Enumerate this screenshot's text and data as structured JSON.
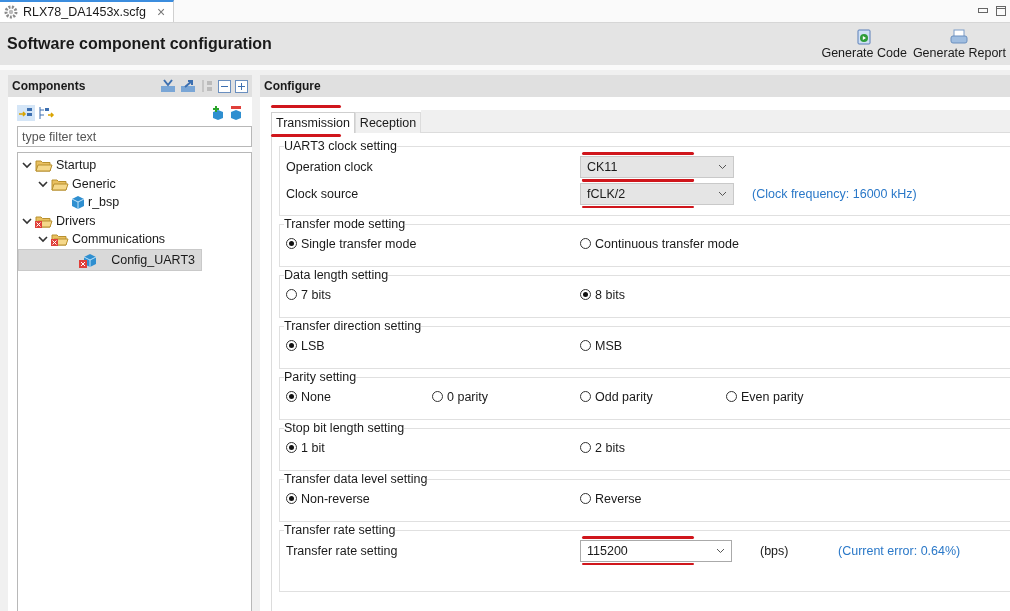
{
  "editor_tab": {
    "title": "RLX78_DA1453x.scfg",
    "close": "×"
  },
  "header": {
    "title": "Software component configuration",
    "actions": [
      {
        "label": "Generate Code",
        "kind": "code"
      },
      {
        "label": "Generate Report",
        "kind": "report"
      }
    ]
  },
  "components": {
    "title": "Components",
    "filter": {
      "placeholder": "type filter text"
    },
    "tree": [
      {
        "label": "Startup",
        "kind": "folder",
        "expanded": true,
        "error": false,
        "selected": false,
        "children": [
          {
            "label": "Generic",
            "kind": "folder",
            "expanded": true,
            "error": false,
            "selected": false,
            "children": [
              {
                "label": "r_bsp",
                "kind": "component",
                "error": false,
                "selected": false
              }
            ]
          }
        ]
      },
      {
        "label": "Drivers",
        "kind": "folder",
        "expanded": true,
        "error": true,
        "selected": false,
        "children": [
          {
            "label": "Communications",
            "kind": "folder",
            "expanded": true,
            "error": true,
            "selected": false,
            "children": [
              {
                "label": "Config_UART3",
                "kind": "component",
                "error": true,
                "selected": true
              }
            ]
          }
        ]
      }
    ]
  },
  "configure": {
    "title": "Configure",
    "tabs": [
      {
        "label": "Transmission",
        "selected": true,
        "highlighted": true
      },
      {
        "label": "Reception",
        "selected": false
      }
    ],
    "groups": [
      {
        "title": "UART3 clock setting",
        "kind": "selects",
        "rows": [
          {
            "label": "Operation clock",
            "value": "CK11",
            "highlighted": true
          },
          {
            "label": "Clock source",
            "value": "fCLK/2",
            "highlighted": true,
            "note": "(Clock frequency: 16000 kHz)"
          }
        ]
      },
      {
        "title": "Transfer mode setting",
        "kind": "radios",
        "options": [
          {
            "label": "Single transfer mode",
            "selected": true
          },
          {
            "label": "Continuous transfer mode",
            "selected": false
          }
        ]
      },
      {
        "title": "Data length setting",
        "kind": "radios",
        "options": [
          {
            "label": "7 bits",
            "selected": false
          },
          {
            "label": "8 bits",
            "selected": true
          }
        ]
      },
      {
        "title": "Transfer direction setting",
        "kind": "radios",
        "options": [
          {
            "label": "LSB",
            "selected": true
          },
          {
            "label": "MSB",
            "selected": false
          }
        ]
      },
      {
        "title": "Parity setting",
        "kind": "radios",
        "options": [
          {
            "label": "None",
            "selected": true
          },
          {
            "label": "0 parity",
            "selected": false
          },
          {
            "label": "Odd parity",
            "selected": false
          },
          {
            "label": "Even parity",
            "selected": false
          }
        ]
      },
      {
        "title": "Stop bit length setting",
        "kind": "radios",
        "options": [
          {
            "label": "1 bit",
            "selected": true
          },
          {
            "label": "2 bits",
            "selected": false
          }
        ]
      },
      {
        "title": "Transfer data level setting",
        "kind": "radios",
        "options": [
          {
            "label": "Non-reverse",
            "selected": true
          },
          {
            "label": "Reverse",
            "selected": false
          }
        ]
      },
      {
        "title": "Transfer rate setting",
        "kind": "selects",
        "tall": true,
        "rows": [
          {
            "label": "Transfer rate setting",
            "value": "115200",
            "highlighted": true,
            "unit": "(bps)",
            "note": "(Current error: 0.64%)"
          }
        ]
      }
    ]
  }
}
